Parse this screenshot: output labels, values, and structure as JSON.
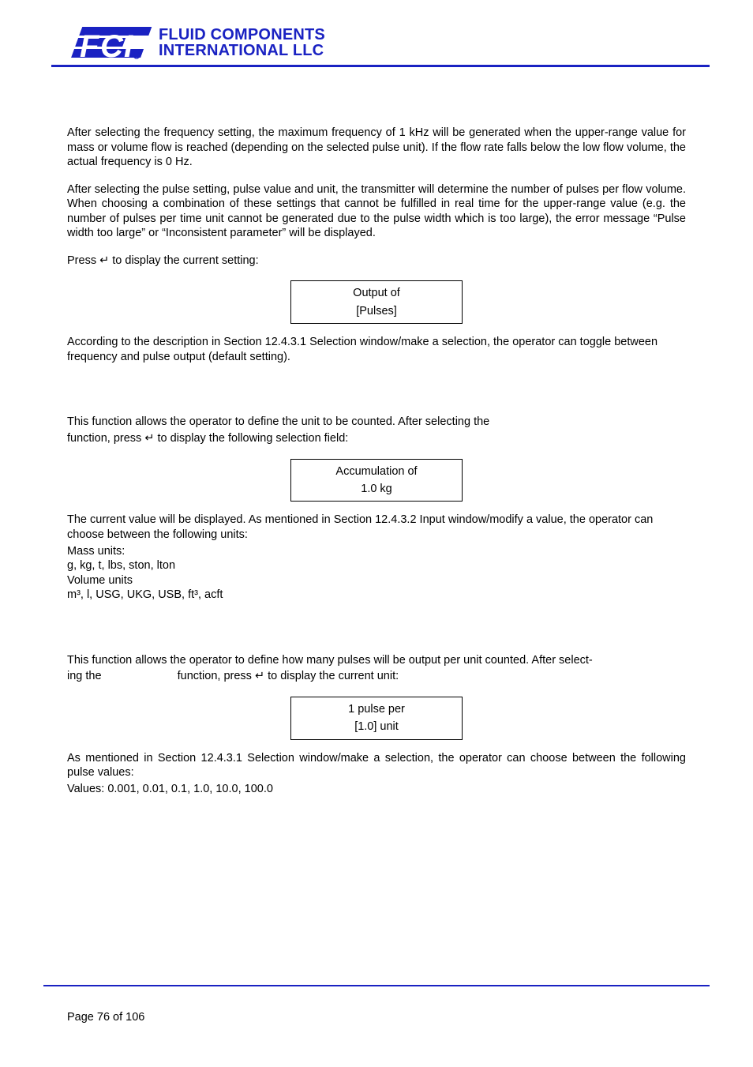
{
  "logo": {
    "line1": "FLUID COMPONENTS",
    "line2": "INTERNATIONAL LLC"
  },
  "para1": "After selecting the frequency setting, the maximum frequency of 1 kHz will be generated when the upper-range value for mass or volume flow is reached (depending on the selected pulse unit). If the flow rate falls below the low flow volume, the actual frequency is 0 Hz.",
  "para2": "After selecting the pulse setting, pulse value and unit, the transmitter will determine the number of pulses per flow volume. When choosing a combination of these settings that cannot be fulfilled in real time for the upper-range value (e.g. the number of pulses per time unit cannot be generated due to the pulse width which is too large), the error message “Pulse width too large” or “Inconsistent parameter” will be displayed.",
  "para3": "Press ↵ to display the current setting:",
  "box1": {
    "line1": "Output of",
    "line2": "[Pulses]"
  },
  "para4": "According to the description in Section 12.4.3.1 Selection window/make a selection, the operator can toggle between frequency and pulse output (default setting).",
  "para5": "This function allows the operator to define the unit to be counted. After selecting the",
  "para5b": "function, press ↵ to display the following selection field:",
  "box2": {
    "line1": "Accumulation of",
    "line2": "1.0 kg"
  },
  "para6": "The current value will be displayed. As mentioned in Section 12.4.3.2 Input window/modify a value, the operator can choose between the following units:",
  "units": {
    "massLabel": "Mass units:",
    "massValues": "g, kg, t, lbs, ston, lton",
    "volLabel": "Volume units",
    "volValues": "m³, l, USG, UKG, USB, ft³, acft"
  },
  "para7a": "This function allows the operator to define how many pulses will be output per unit counted. After select-",
  "para7b_prefix": "ing the",
  "para7b_suffix": "function, press ↵  to display the current unit:",
  "box3": {
    "line1": "1 pulse per",
    "line2": "[1.0] unit"
  },
  "para8": "As mentioned in Section 12.4.3.1 Selection window/make a selection, the operator can choose between the following pulse values:",
  "valuesLine": "Values: 0.001, 0.01, 0.1, 1.0, 10.0, 100.0",
  "footer": "Page 76 of 106"
}
